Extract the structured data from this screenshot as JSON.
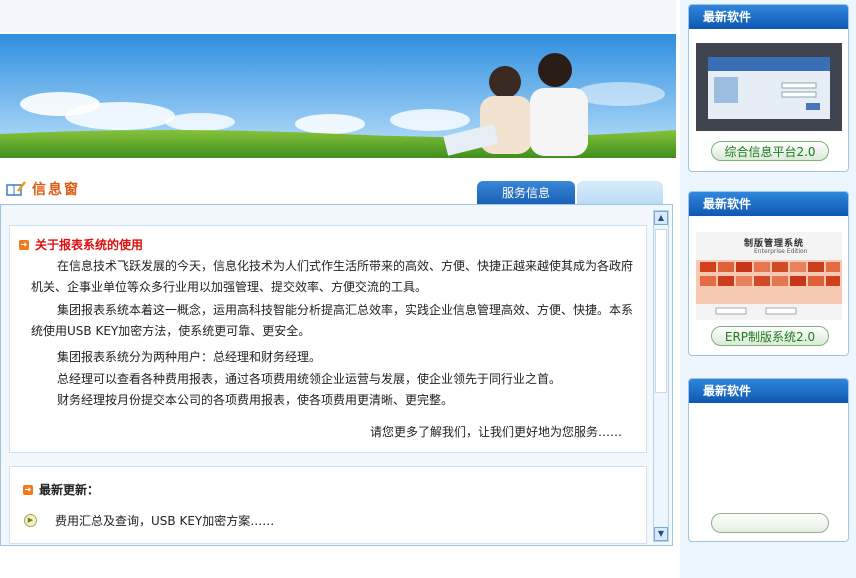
{
  "info": {
    "title": "信息窗",
    "tabs": [
      {
        "label": "服务信息",
        "active": true
      },
      {
        "label": "",
        "active": false
      }
    ]
  },
  "about": {
    "title": "关于报表系统的使用",
    "paragraphs": [
      "在信息技术飞跃发展的今天，信息化技术为人们式作生活所带来的高效、方便、快捷正越来越使其成为各政府机关、企事业单位等众多行业用以加强管理、提交效率、方便交流的工具。",
      "集团报表系统本着这一概念，运用高科技智能分析提高汇总效率，实践企业信息管理高效、方便、快捷。本系统使用USB KEY加密方法，使系统更可靠、更安全。"
    ],
    "lines": [
      "集团报表系统分为两种用户：总经理和财务经理。",
      "总经理可以查看各种费用报表，通过各项费用统领企业运营与发展，使企业领先于同行业之首。",
      "财务经理按月份提交本公司的各项费用报表，使各项费用更清晰、更完整。"
    ],
    "more": "请您更多了解我们，让我们更好地为您服务……"
  },
  "updates": {
    "title": "最新更新：",
    "items": [
      "费用汇总及查询，USB KEY加密方案……"
    ]
  },
  "sidebar": {
    "boxes": [
      {
        "title": "最新软件",
        "button": "综合信息平台2.0"
      },
      {
        "title": "最新软件",
        "button": "ERP制版系统2.0"
      },
      {
        "title": "最新软件",
        "button": ""
      }
    ],
    "thumb2_title": "制版管理系统",
    "thumb2_subtitle": "Enterprise Edition"
  },
  "colors": {
    "accent_orange": "#e05a12",
    "header_blue": "#1a5fb4",
    "link_red": "#dd1111"
  }
}
